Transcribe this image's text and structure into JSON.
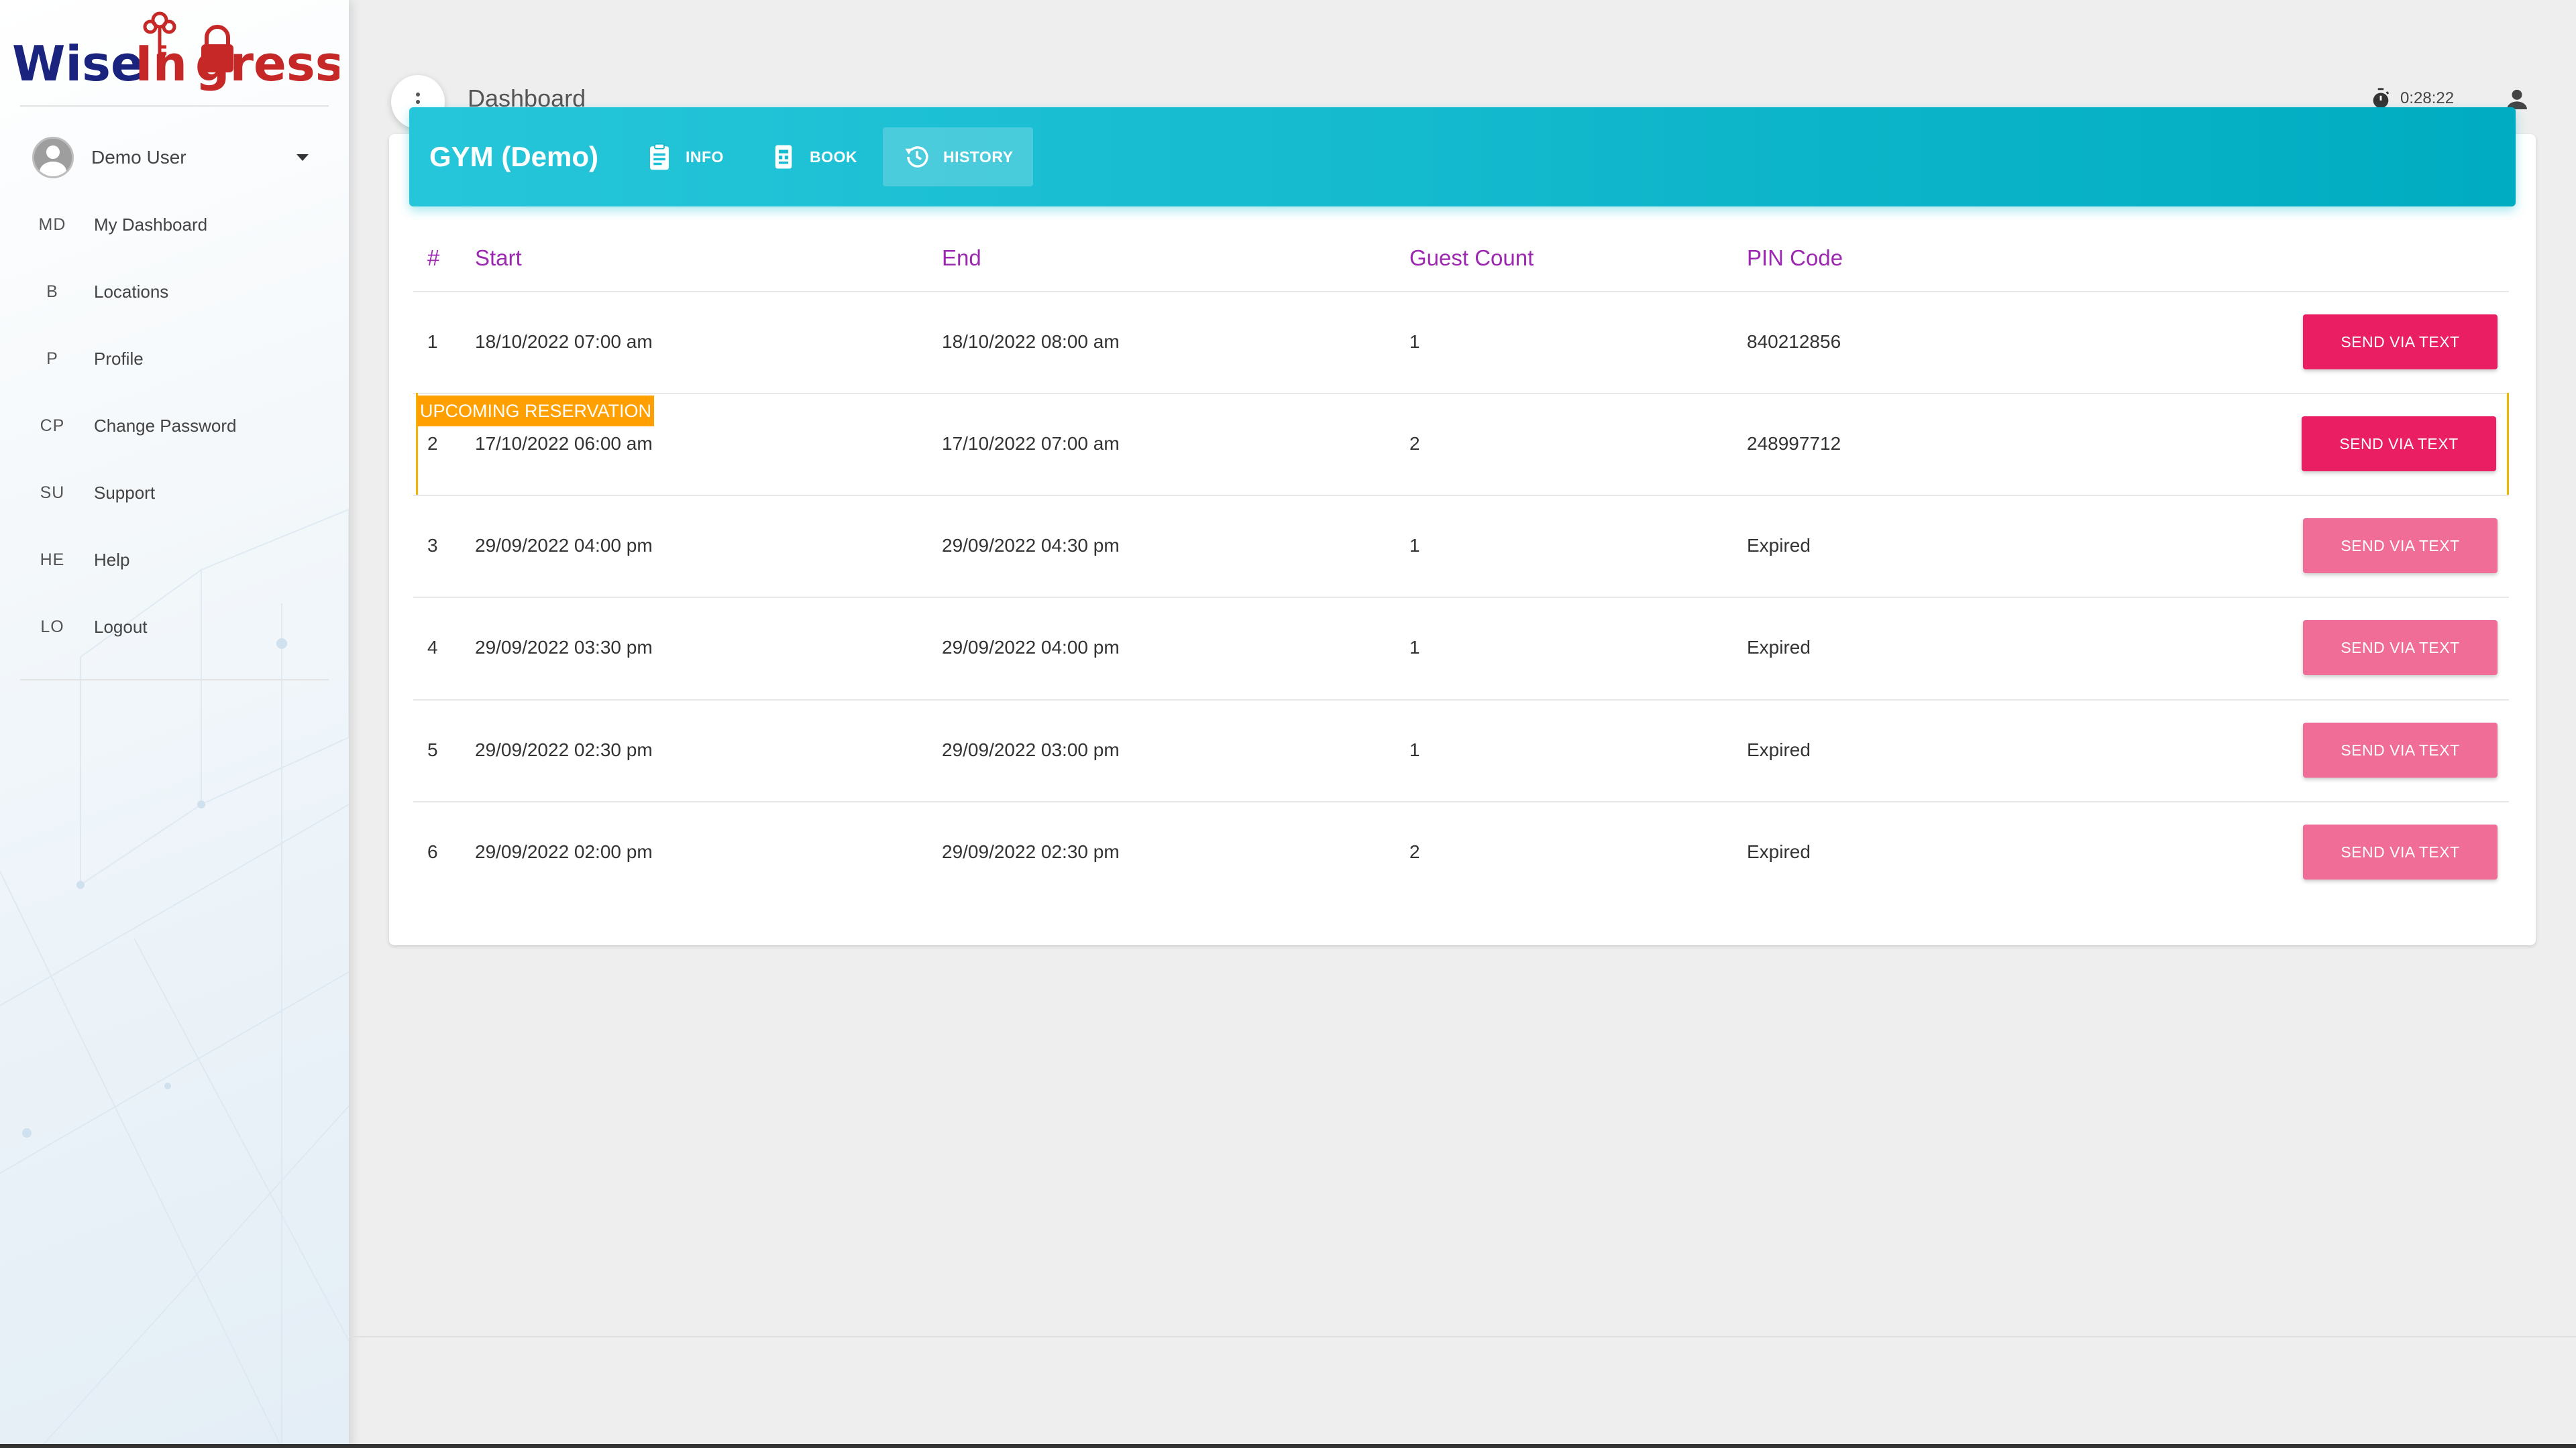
{
  "app": {
    "brand": "WiseIngress"
  },
  "user": {
    "name": "Demo User"
  },
  "nav": [
    {
      "abbr": "MD",
      "label": "My Dashboard"
    },
    {
      "abbr": "B",
      "label": "Locations"
    },
    {
      "abbr": "P",
      "label": "Profile"
    },
    {
      "abbr": "CP",
      "label": "Change Password"
    },
    {
      "abbr": "SU",
      "label": "Support"
    },
    {
      "abbr": "HE",
      "label": "Help"
    },
    {
      "abbr": "LO",
      "label": "Logout"
    }
  ],
  "topbar": {
    "title": "Dashboard",
    "timer": "0:28:22"
  },
  "location": {
    "title": "GYM (Demo)",
    "tabs": [
      {
        "label": "INFO",
        "icon": "clipboard-icon"
      },
      {
        "label": "BOOK",
        "icon": "book-icon"
      },
      {
        "label": "HISTORY",
        "icon": "history-icon"
      }
    ],
    "active_tab": "HISTORY"
  },
  "table": {
    "headers": {
      "num": "#",
      "start": "Start",
      "end": "End",
      "guests": "Guest Count",
      "pin": "PIN Code"
    },
    "upcoming_label": "UPCOMING RESERVATION",
    "rows": [
      {
        "num": "1",
        "start": "18/10/2022 07:00 am",
        "end": "18/10/2022 08:00 am",
        "guests": "1",
        "pin": "840212856",
        "action": "SEND VIA TEXT"
      },
      {
        "num": "2",
        "start": "17/10/2022 06:00 am",
        "end": "17/10/2022 07:00 am",
        "guests": "2",
        "pin": "248997712",
        "action": "SEND VIA TEXT"
      },
      {
        "num": "3",
        "start": "29/09/2022 04:00 pm",
        "end": "29/09/2022 04:30 pm",
        "guests": "1",
        "pin": "Expired",
        "action": "SEND VIA TEXT"
      },
      {
        "num": "4",
        "start": "29/09/2022 03:30 pm",
        "end": "29/09/2022 04:00 pm",
        "guests": "1",
        "pin": "Expired",
        "action": "SEND VIA TEXT"
      },
      {
        "num": "5",
        "start": "29/09/2022 02:30 pm",
        "end": "29/09/2022 03:00 pm",
        "guests": "1",
        "pin": "Expired",
        "action": "SEND VIA TEXT"
      },
      {
        "num": "6",
        "start": "29/09/2022 02:00 pm",
        "end": "29/09/2022 02:30 pm",
        "guests": "2",
        "pin": "Expired",
        "action": "SEND VIA TEXT"
      }
    ]
  },
  "colors": {
    "header_accent": "#00bcd4",
    "column_header": "#9c27b0",
    "send_active": "#e91e63",
    "send_dim": "#f06d98",
    "upcoming": "#ffa000",
    "logo_red": "#c62828",
    "logo_navy": "#1a237e"
  }
}
